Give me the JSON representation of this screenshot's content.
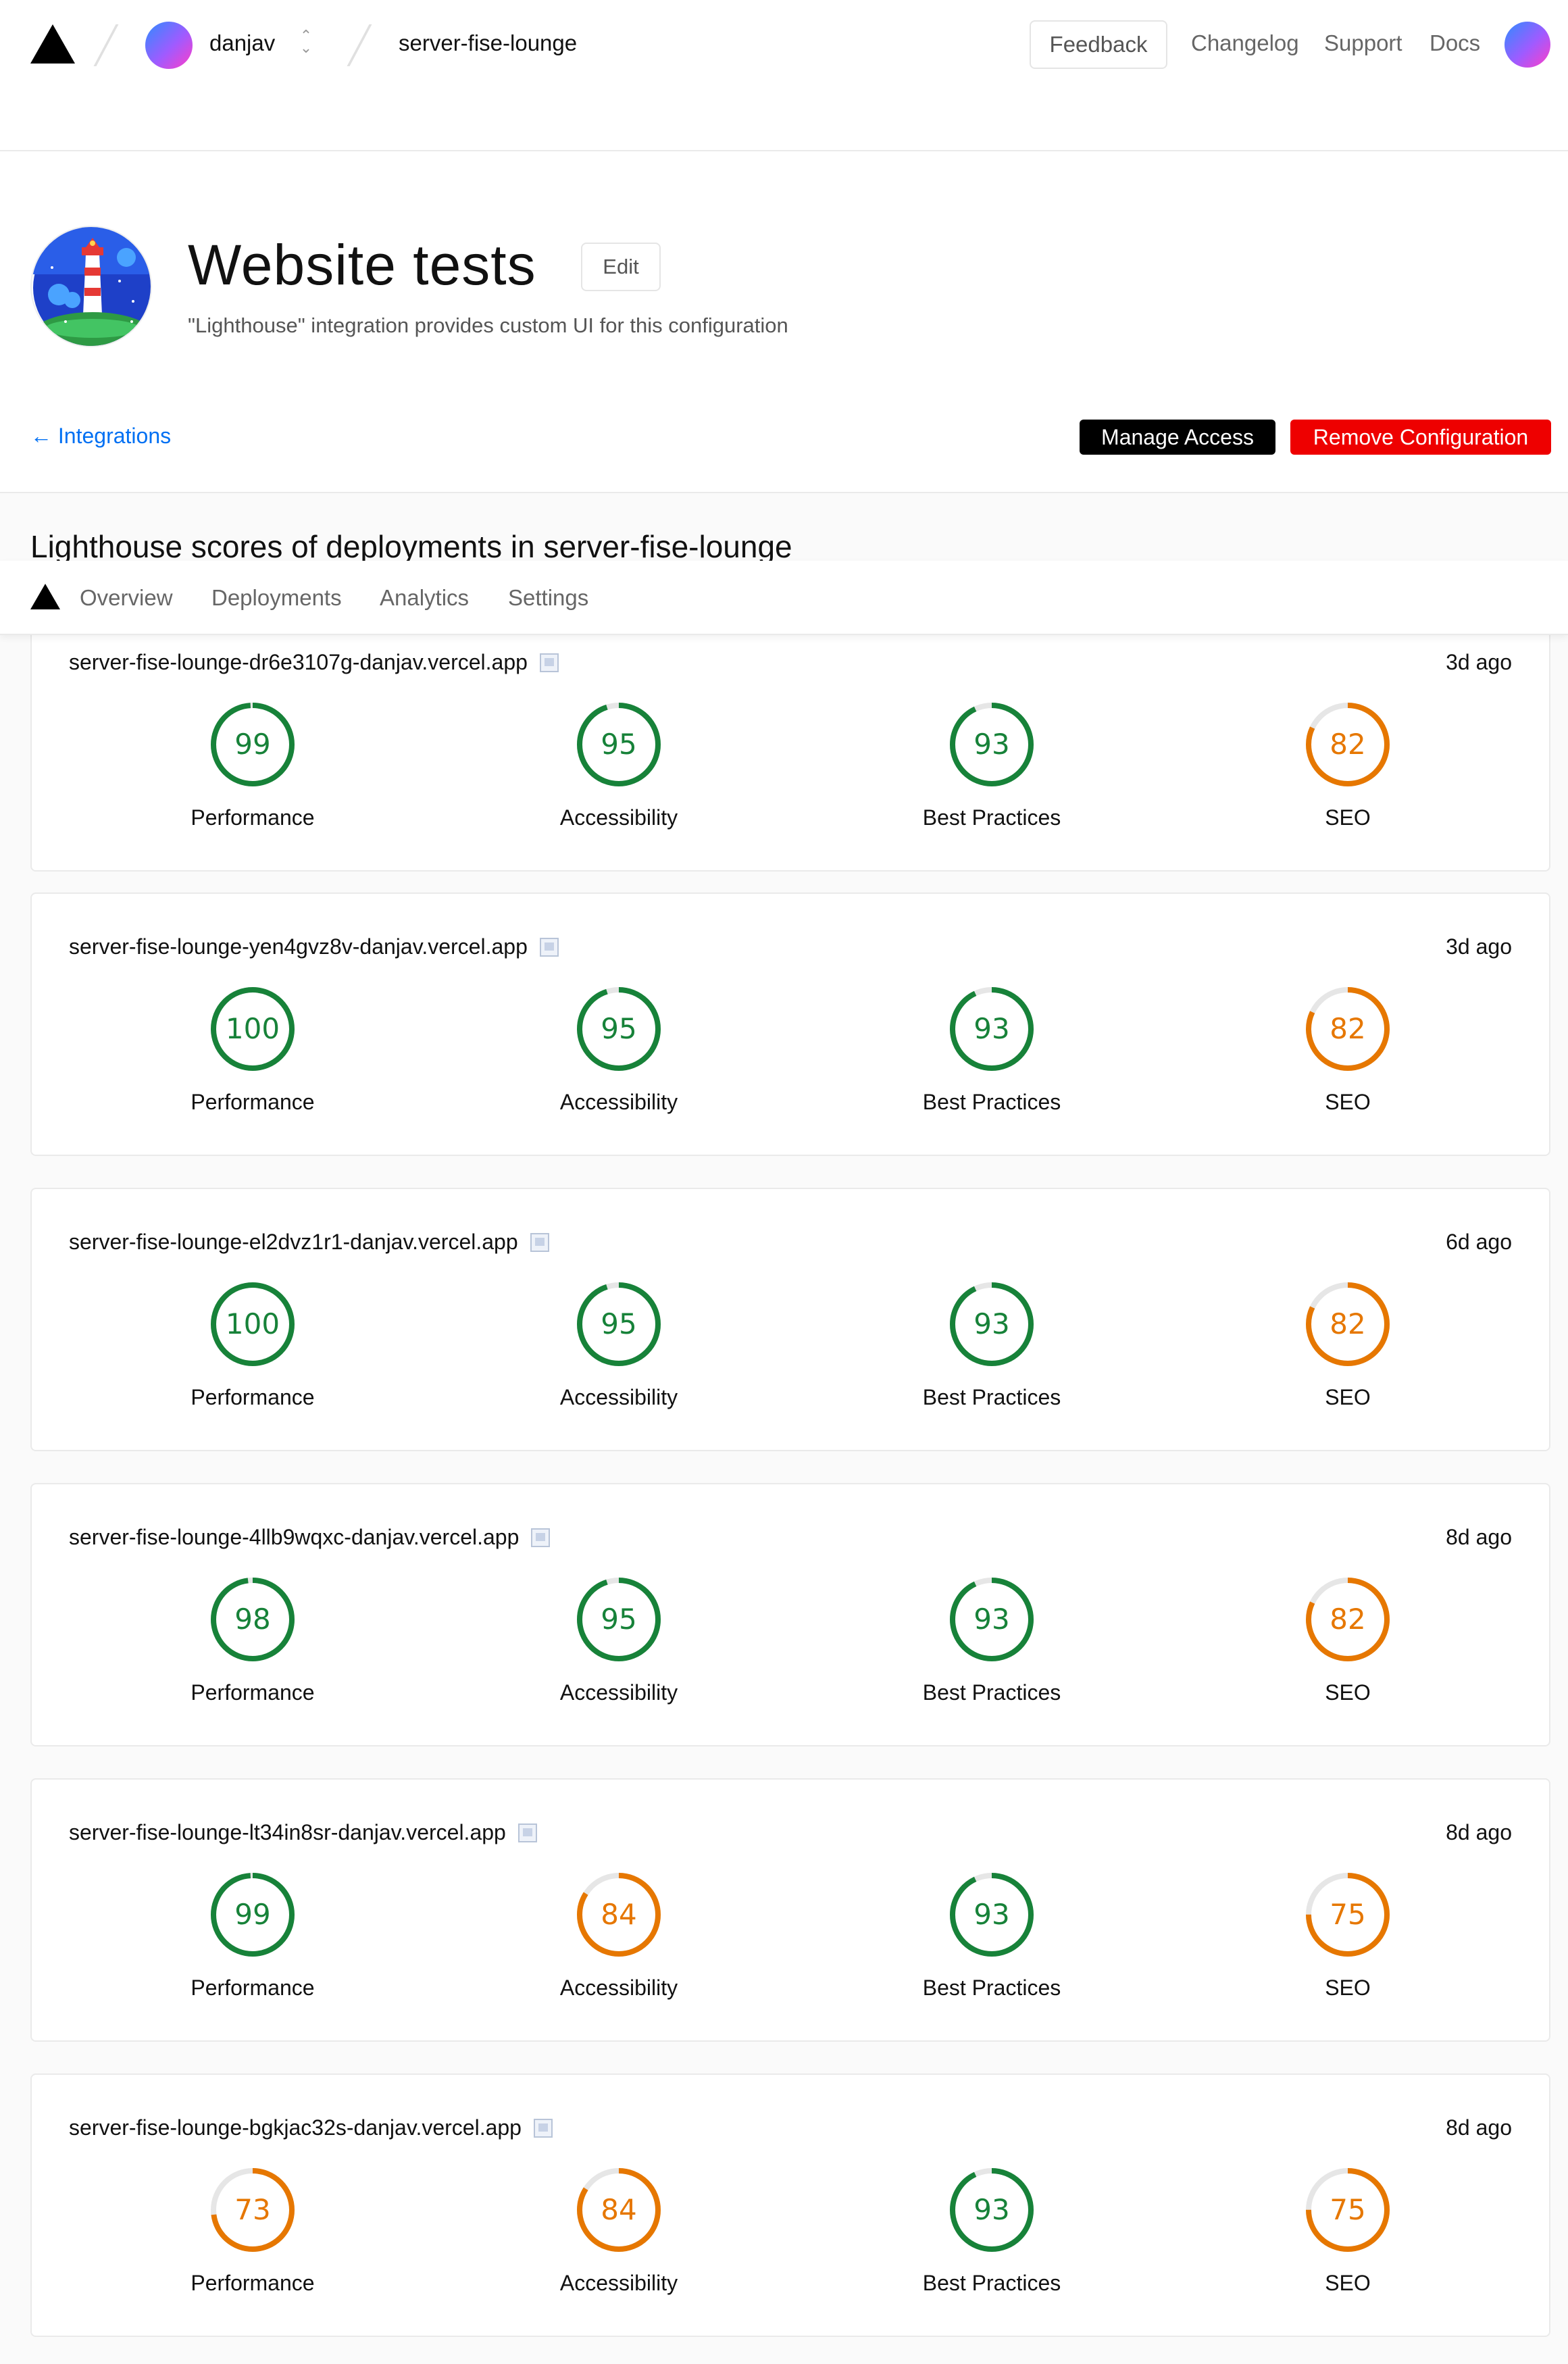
{
  "topbar": {
    "team_name": "danjav",
    "project_name": "server-fise-lounge",
    "feedback_label": "Feedback",
    "nav": [
      "Changelog",
      "Support",
      "Docs"
    ]
  },
  "header": {
    "title": "Website tests",
    "edit_label": "Edit",
    "subtitle": "\"Lighthouse\" integration provides custom UI for this configuration",
    "back_label": "← Integrations",
    "manage_label": "Manage Access",
    "remove_label": "Remove Configuration"
  },
  "section_title": "Lighthouse scores of deployments in server-fise-lounge",
  "subnav": [
    "Overview",
    "Deployments",
    "Analytics",
    "Settings"
  ],
  "metric_labels": [
    "Performance",
    "Accessibility",
    "Best Practices",
    "SEO"
  ],
  "colors": {
    "pass": "#178239",
    "average": "#e67700",
    "track": "#e6e6e6",
    "danger": "#ee0000",
    "link": "#0070f3"
  },
  "deployments": [
    {
      "url": "server-fise-lounge-dr6e3107g-danjav.vercel.app",
      "time": "3d ago",
      "scores": [
        99,
        95,
        93,
        82
      ]
    },
    {
      "url": "server-fise-lounge-yen4gvz8v-danjav.vercel.app",
      "time": "3d ago",
      "scores": [
        100,
        95,
        93,
        82
      ]
    },
    {
      "url": "server-fise-lounge-el2dvz1r1-danjav.vercel.app",
      "time": "6d ago",
      "scores": [
        100,
        95,
        93,
        82
      ]
    },
    {
      "url": "server-fise-lounge-4llb9wqxc-danjav.vercel.app",
      "time": "8d ago",
      "scores": [
        98,
        95,
        93,
        82
      ]
    },
    {
      "url": "server-fise-lounge-lt34in8sr-danjav.vercel.app",
      "time": "8d ago",
      "scores": [
        99,
        84,
        93,
        75
      ]
    },
    {
      "url": "server-fise-lounge-bgkjac32s-danjav.vercel.app",
      "time": "8d ago",
      "scores": [
        73,
        84,
        93,
        75
      ]
    }
  ]
}
